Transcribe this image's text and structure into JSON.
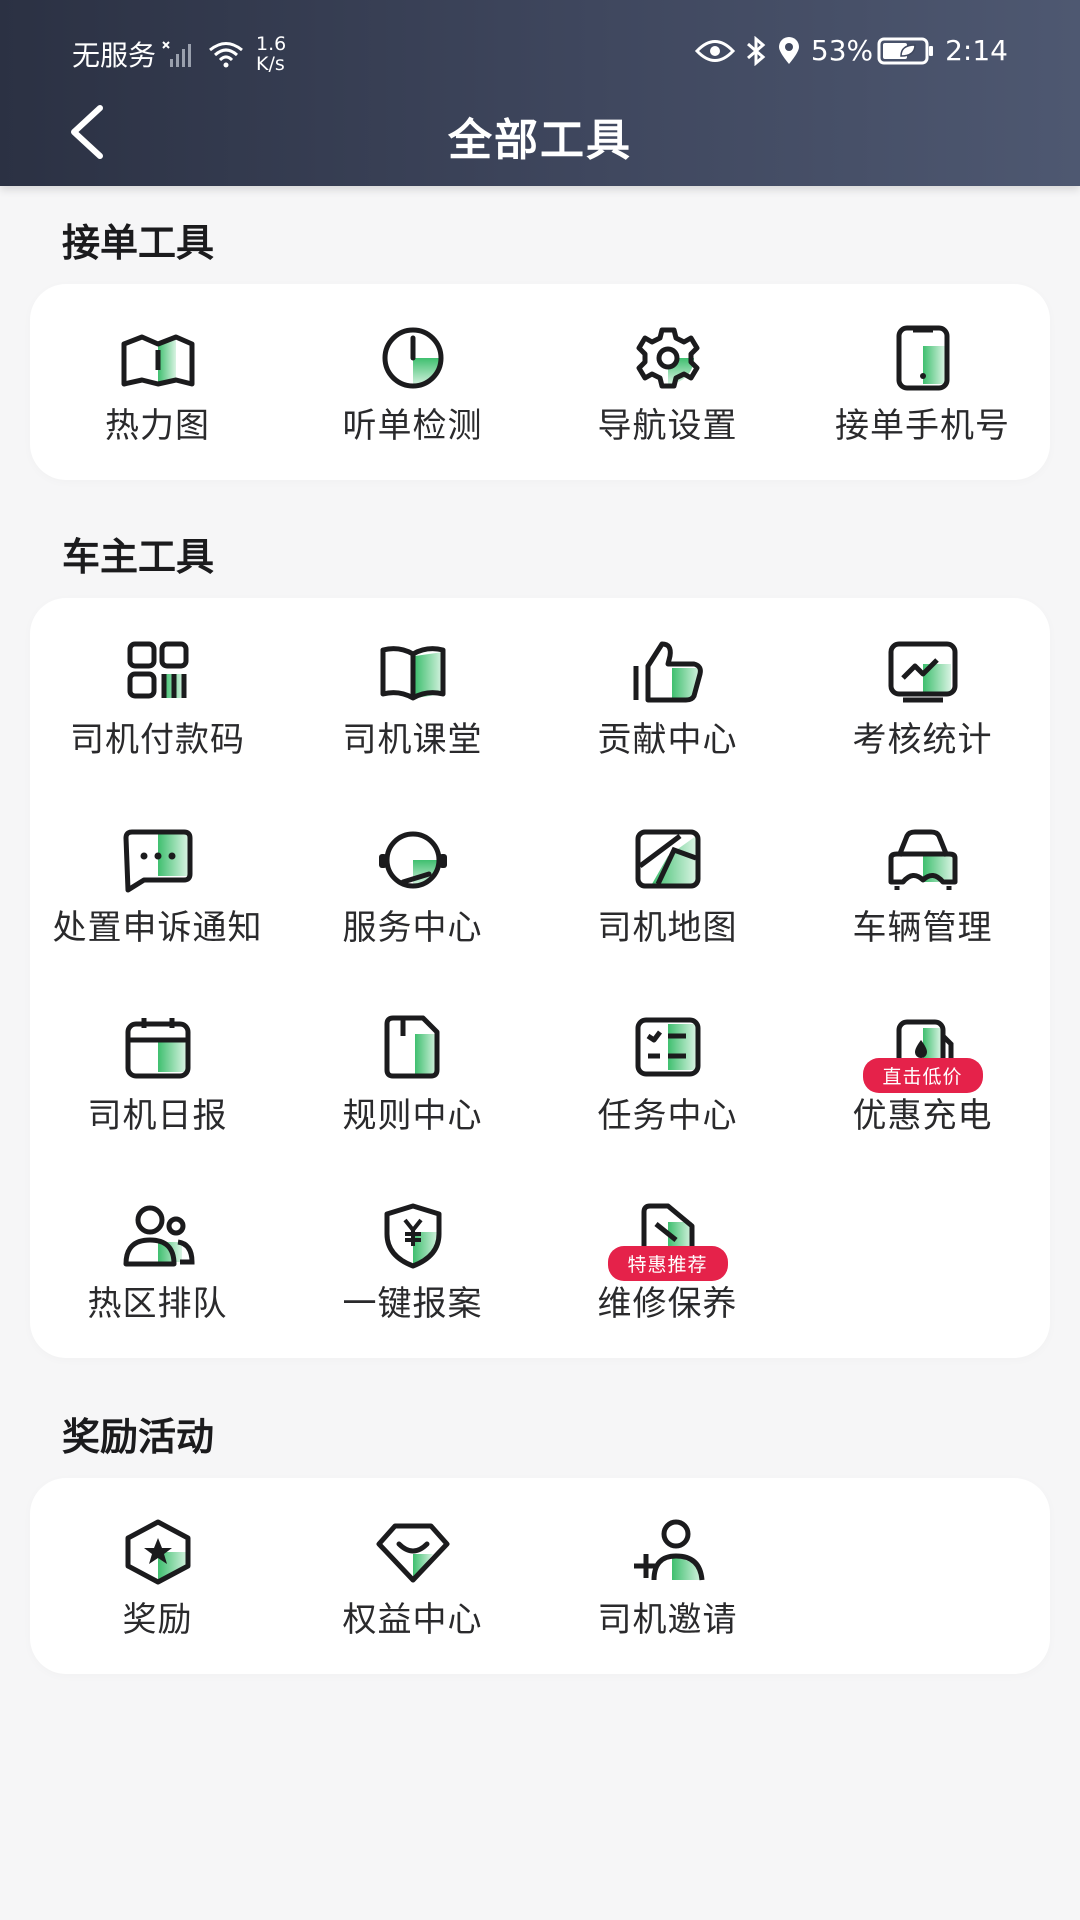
{
  "status_bar": {
    "carrier": "无服务",
    "speed_value": "1.6",
    "speed_unit": "K/s",
    "battery": "53%",
    "time": "2:14"
  },
  "nav": {
    "title": "全部工具"
  },
  "sections": [
    {
      "title": "接单工具",
      "items": [
        {
          "label": "热力图",
          "icon": "heatmap-icon"
        },
        {
          "label": "听单检测",
          "icon": "order-detect-icon"
        },
        {
          "label": "导航设置",
          "icon": "gear-icon"
        },
        {
          "label": "接单手机号",
          "icon": "phone-icon"
        }
      ]
    },
    {
      "title": "车主工具",
      "items": [
        {
          "label": "司机付款码",
          "icon": "payment-code-icon"
        },
        {
          "label": "司机课堂",
          "icon": "book-icon"
        },
        {
          "label": "贡献中心",
          "icon": "thumbs-up-icon"
        },
        {
          "label": "考核统计",
          "icon": "chart-icon"
        },
        {
          "label": "处置申诉通知",
          "icon": "message-icon"
        },
        {
          "label": "服务中心",
          "icon": "headset-icon"
        },
        {
          "label": "司机地图",
          "icon": "map-icon"
        },
        {
          "label": "车辆管理",
          "icon": "car-icon"
        },
        {
          "label": "司机日报",
          "icon": "calendar-icon"
        },
        {
          "label": "规则中心",
          "icon": "document-icon"
        },
        {
          "label": "任务中心",
          "icon": "task-list-icon"
        },
        {
          "label": "优惠充电",
          "icon": "charging-icon",
          "badge": "直击低价"
        },
        {
          "label": "热区排队",
          "icon": "users-icon"
        },
        {
          "label": "一键报案",
          "icon": "yen-shield-icon"
        },
        {
          "label": "维修保养",
          "icon": "oil-can-icon",
          "badge": "特惠推荐"
        }
      ]
    },
    {
      "title": "奖励活动",
      "items": [
        {
          "label": "奖励",
          "icon": "reward-star-icon"
        },
        {
          "label": "权益中心",
          "icon": "diamond-icon"
        },
        {
          "label": "司机邀请",
          "icon": "add-user-icon"
        }
      ]
    }
  ],
  "colors": {
    "header": "#3f475e",
    "accent_green": "#3fbf6f",
    "badge_red": "#e5224a"
  }
}
